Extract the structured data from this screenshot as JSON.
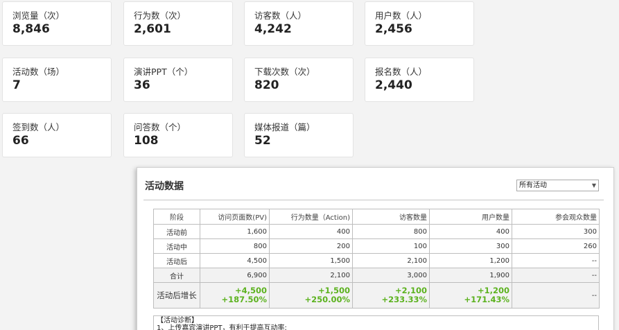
{
  "stats": [
    {
      "label": "浏览量（次）",
      "value": "8,846"
    },
    {
      "label": "行为数（次）",
      "value": "2,601"
    },
    {
      "label": "访客数（人）",
      "value": "4,242"
    },
    {
      "label": "用户数（人）",
      "value": "2,456"
    },
    {
      "label": "活动数（场）",
      "value": "7"
    },
    {
      "label": "演讲PPT（个）",
      "value": "36"
    },
    {
      "label": "下载次数（次）",
      "value": "820"
    },
    {
      "label": "报名数（人）",
      "value": "2,440"
    },
    {
      "label": "签到数（人）",
      "value": "66"
    },
    {
      "label": "问答数（个）",
      "value": "108"
    },
    {
      "label": "媒体报道（篇）",
      "value": "52"
    }
  ],
  "panel": {
    "title": "活动数据",
    "select_value": "所有活动",
    "table": {
      "headers": [
        "阶段",
        "访问页面数(PV)",
        "行为数量（Action)",
        "访客数量",
        "用户数量",
        "参会观众数量"
      ],
      "rows": [
        [
          "活动前",
          "1,600",
          "400",
          "800",
          "400",
          "300"
        ],
        [
          "活动中",
          "800",
          "200",
          "100",
          "300",
          "260"
        ],
        [
          "活动后",
          "4,500",
          "1,500",
          "2,100",
          "1,200",
          "--"
        ],
        [
          "合计",
          "6,900",
          "2,100",
          "3,000",
          "1,900",
          "--"
        ]
      ],
      "growth": {
        "label": "活动后增长",
        "cells": [
          {
            "abs": "+4,500",
            "pct": "+187.50%"
          },
          {
            "abs": "+1,500",
            "pct": "+250.00%"
          },
          {
            "abs": "+2,100",
            "pct": "+233.33%"
          },
          {
            "abs": "+1,200",
            "pct": "+171.43%"
          }
        ],
        "last": "--"
      }
    },
    "diagnosis": {
      "title": "【活动诊断】",
      "line1": "1、上传嘉宾演讲PPT，有利于提高互动率;"
    }
  }
}
